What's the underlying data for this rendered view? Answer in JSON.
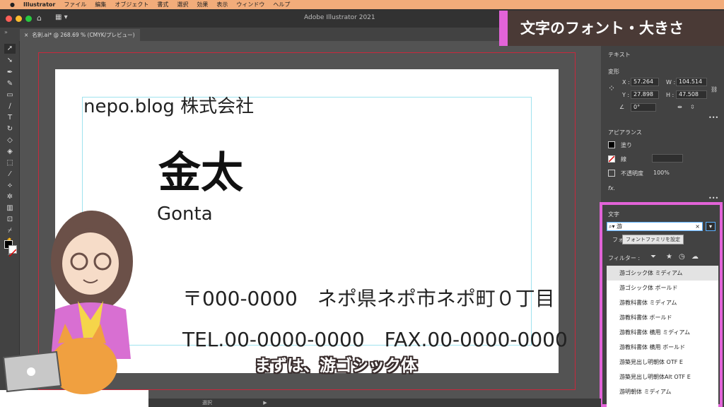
{
  "menubar": {
    "app": "Illustrator",
    "items": [
      "ファイル",
      "編集",
      "オブジェクト",
      "書式",
      "選択",
      "効果",
      "表示",
      "ウィンドウ",
      "ヘルプ"
    ]
  },
  "window": {
    "title": "Adobe Illustrator 2021",
    "tab_label": "名刺.ai* @ 268.69 % (CMYK/プレビュー)",
    "tab_close": "×",
    "status_tool": "選択"
  },
  "badge": {
    "text": "文字のフォント・大きさ"
  },
  "caption": {
    "text": "まずは、游ゴシック体"
  },
  "artboard": {
    "company": "nepo.blog 株式会社",
    "name": "金太",
    "name_romaji": "Gonta",
    "address": "〒000-0000　ネポ県ネポ市ネポ町０丁目",
    "phone_fax": "TEL.00-0000-0000　FAX.00-0000-0000"
  },
  "panel": {
    "text_section": "テキスト",
    "transform_section": "変形",
    "x_label": "X :",
    "x_value": "57.264",
    "y_label": "Y :",
    "y_value": "27.898",
    "w_label": "W :",
    "w_value": "104.514",
    "h_label": "H :",
    "h_value": "47.508",
    "angle_value": "0°",
    "appearance_section": "アピアランス",
    "fill_label": "塗り",
    "stroke_label": "線",
    "opacity_label": "不透明度",
    "opacity_value": "100%",
    "fx_label": "fx.",
    "more": "•••"
  },
  "character": {
    "title": "文字",
    "search_value": "游",
    "search_clear": "×",
    "tooltip": "フォントファミリを設定",
    "tab_partial": "フォ",
    "filter_label": "フィルター :",
    "fonts": [
      "游ゴシック体 ミディアム",
      "游ゴシック体 ボールド",
      "游教科書体 ミディアム",
      "游教科書体 ボールド",
      "游教科書体 横用 ミディアム",
      "游教科書体 横用 ボールド",
      "游築見出し明朝体 OTF E",
      "游築見出し明朝体Alt OTF E",
      "游明朝体 ミディアム"
    ],
    "selected_index": 0
  },
  "colors": {
    "menubar": "#f2ac7a",
    "accent_pink": "#e263d8",
    "badge_bg": "#4a3a36",
    "bleed_red": "#c8283c",
    "guide_cyan": "#9fe3ef"
  }
}
